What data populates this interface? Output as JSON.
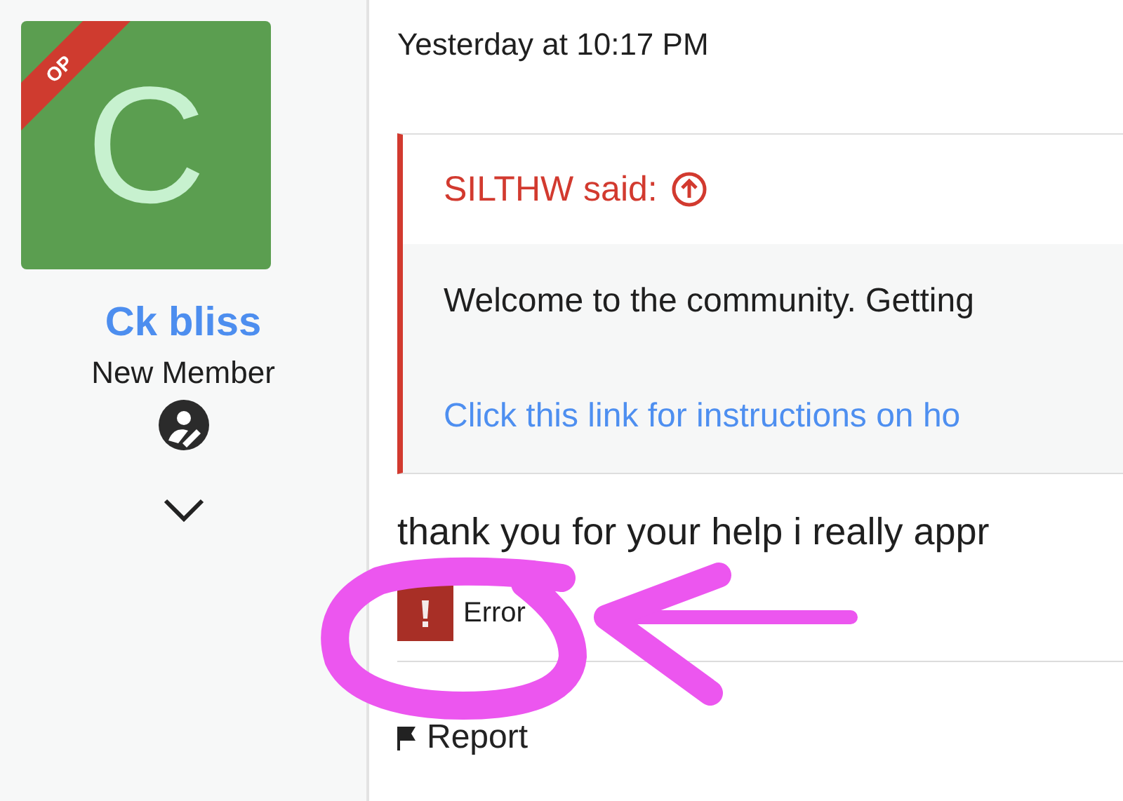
{
  "user": {
    "avatar_letter": "C",
    "badge": "OP",
    "name": "Ck bliss",
    "rank": "New Member"
  },
  "post": {
    "timestamp": "Yesterday at 10:17 PM",
    "quote": {
      "author_line": "SILTHW said:",
      "text": "Welcome to the community. Getting",
      "link": "Click this link for instructions on ho"
    },
    "body": "thank you for your help i really appr",
    "attachment": {
      "label": "Error"
    },
    "actions": [
      "Report"
    ]
  }
}
